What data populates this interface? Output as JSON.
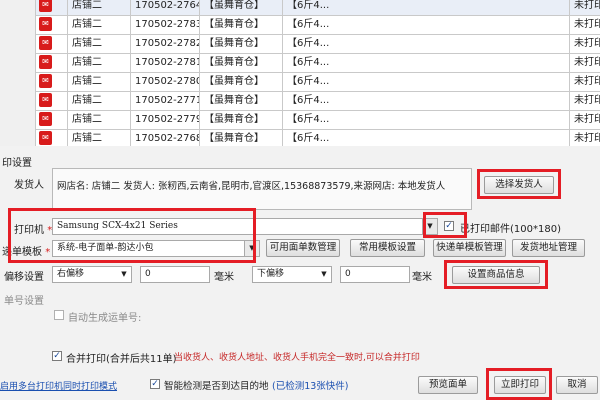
{
  "orders": [
    {
      "store": "店铺二",
      "order_no": "170502-2764...",
      "warehouse": "【虽舞育仓】",
      "product": "【6斤4...",
      "status": "未打印"
    },
    {
      "store": "店铺二",
      "order_no": "170502-2783...",
      "warehouse": "【虽舞育仓】",
      "product": "【6斤4...",
      "status": "未打印"
    },
    {
      "store": "店铺二",
      "order_no": "170502-2782...",
      "warehouse": "【虽舞育仓】",
      "product": "【6斤4...",
      "status": "未打印"
    },
    {
      "store": "店铺二",
      "order_no": "170502-2781...",
      "warehouse": "【虽舞育仓】",
      "product": "【6斤4...",
      "status": "未打印"
    },
    {
      "store": "店铺二",
      "order_no": "170502-2780...",
      "warehouse": "【虽舞育仓】",
      "product": "【6斤4...",
      "status": "未打印"
    },
    {
      "store": "店铺二",
      "order_no": "170502-2771...",
      "warehouse": "【虽舞育仓】",
      "product": "【6斤4...",
      "status": "未打印"
    },
    {
      "store": "店铺二",
      "order_no": "170502-2779...",
      "warehouse": "【虽舞育仓】",
      "product": "【6斤4...",
      "status": "未打印"
    },
    {
      "store": "店铺二",
      "order_no": "170502-2768...",
      "warehouse": "【虽舞育仓】",
      "product": "【6斤4...",
      "status": "未打印"
    }
  ],
  "settings": {
    "section_title": "印设置",
    "sender_label": "发货人",
    "sender_info": "网店名: 店铺二 发货人: 张籾西,云南省,昆明市,官渡区,15368873579,来源网店: 本地发货人",
    "choose_sender_btn": "选择发货人",
    "printer_label": "打印机",
    "printer_required": "*",
    "printer_value": "Samsung SCX-4x21 Series",
    "attach_label": "已打印邮件(100*180)",
    "attach_checked_mark": "✓",
    "template_label": "递单模板",
    "template_required": "*",
    "template_value": "系统-电子面单-韵达小包",
    "btn_available_templates": "可用面单数管理",
    "btn_common_template": "常用模板设置",
    "btn_express_template": "快递单模板管理",
    "btn_ship_address": "发货地址管理",
    "offset_label": "偏移设置",
    "h_offset_dir": "右偏移",
    "h_offset_value": "0",
    "h_unit": "毫米",
    "v_offset_dir": "下偏移",
    "v_offset_value": "0",
    "v_unit": "毫米",
    "btn_goods_info": "设置商品信息",
    "ship_no_label": "单号设置",
    "auto_ship_no": "自动生成运单号:",
    "merge_print_label": "合并打印(合并后共11单)",
    "merge_print_hint": "当收货人、收货人地址、收货人手机完全一致时,可以合并打印",
    "multi_printer_link": "启用多台打印机同时打印模式",
    "smart_check_label": "智能检测是否到达目的地",
    "smart_check_link": "(已检测13张快件)",
    "btn_preview": "预览面单",
    "btn_print_now": "立即打印",
    "btn_cancel": "取消"
  }
}
